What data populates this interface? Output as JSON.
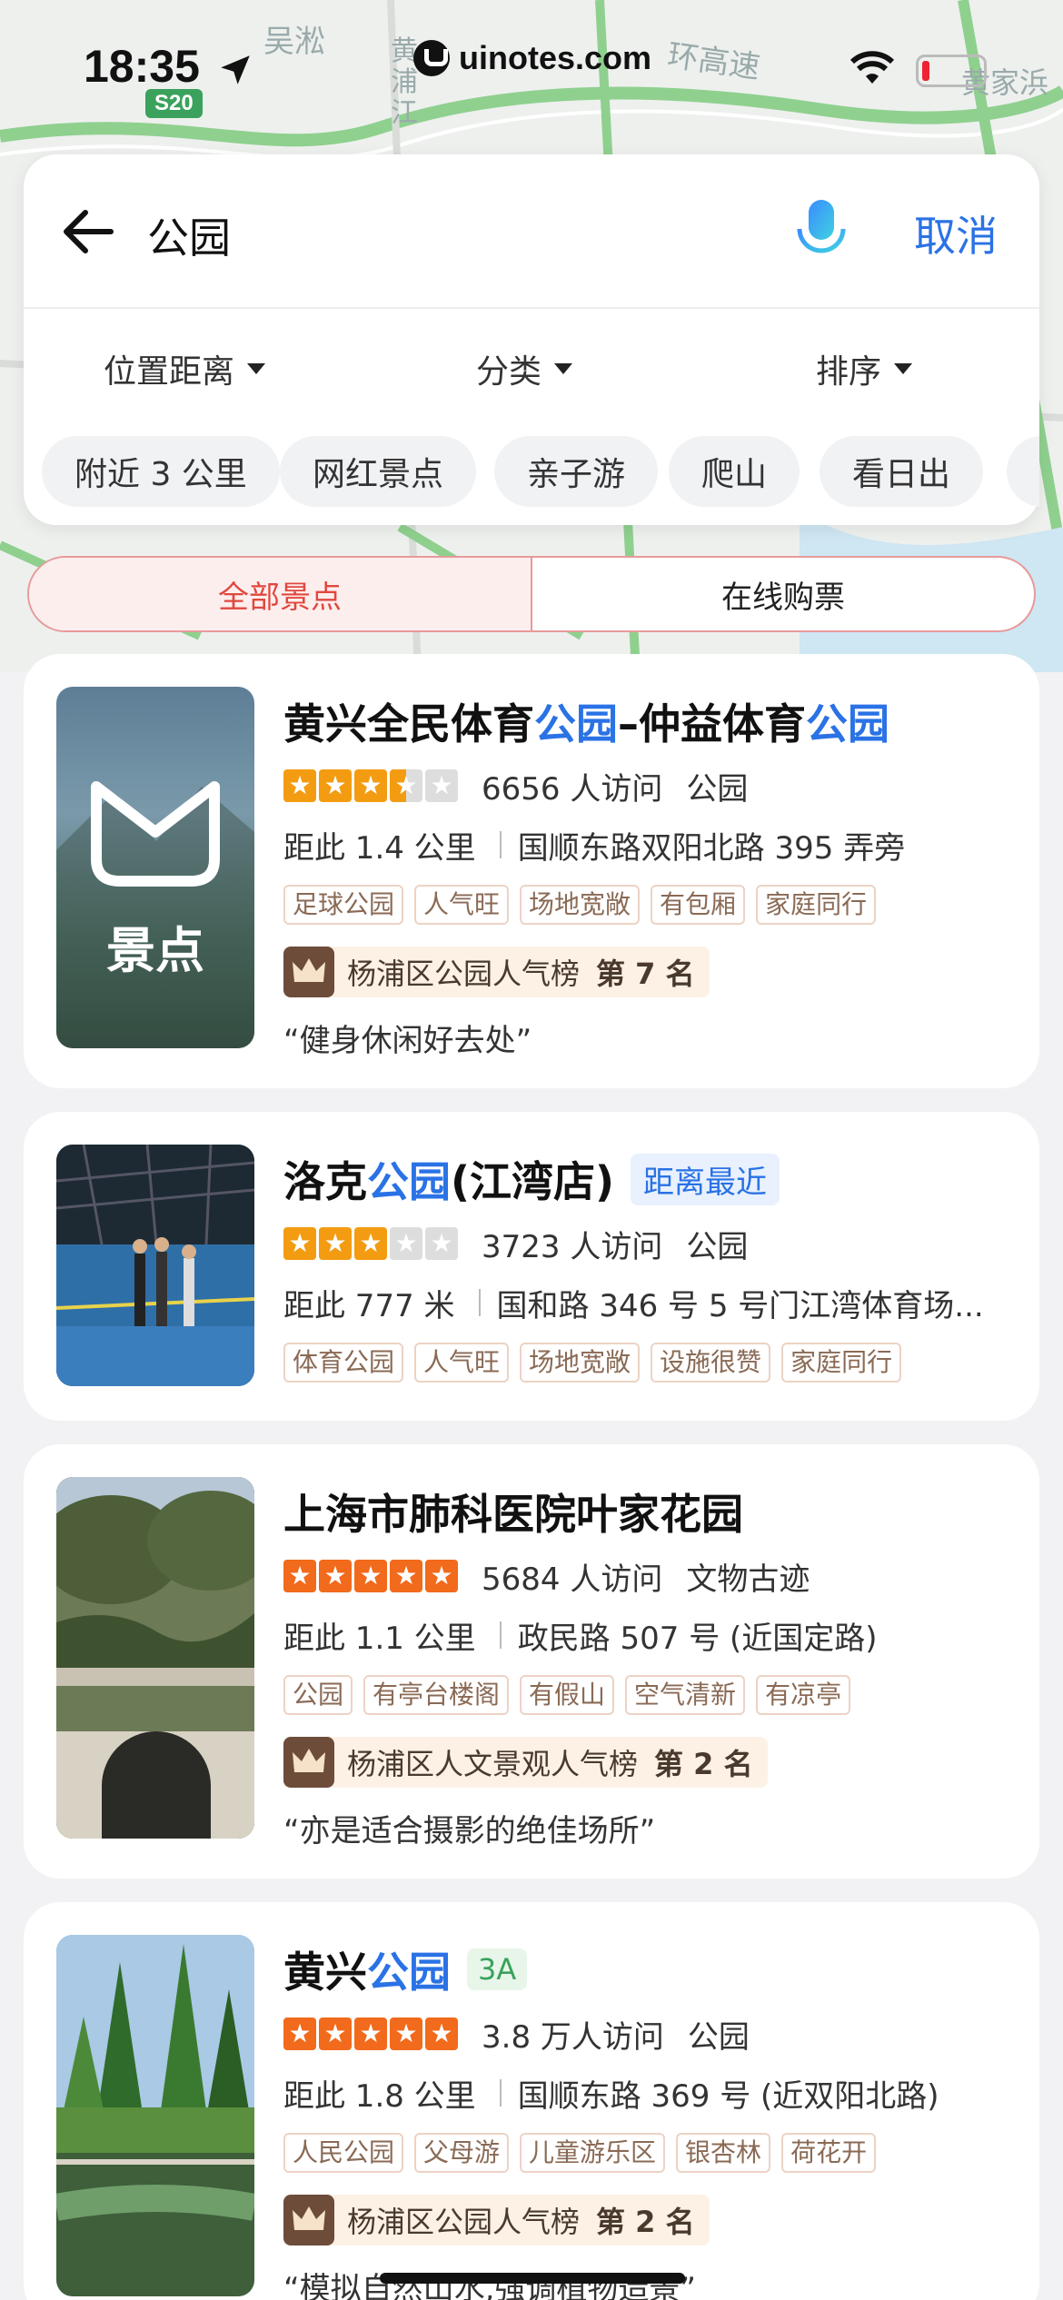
{
  "status_bar": {
    "time": "18:35",
    "site": "uinotes.com",
    "road_badge": "S20"
  },
  "map": {
    "labels": [
      "吴淞",
      "黄浦江",
      "环高速",
      "黄家浜"
    ]
  },
  "search": {
    "query": "公园",
    "cancel_label": "取消"
  },
  "filters": [
    {
      "label": "位置距离"
    },
    {
      "label": "分类"
    },
    {
      "label": "排序"
    }
  ],
  "chips": [
    "附近 3 公里",
    "网红景点",
    "亲子游",
    "爬山",
    "看日出"
  ],
  "segment": {
    "tab_all": "全部景点",
    "tab_tickets": "在线购票"
  },
  "results": [
    {
      "title_parts": [
        "黄兴全民体育",
        "公园",
        "–仲益体育",
        "公园"
      ],
      "thumb_label": "景点",
      "rating": 3.5,
      "visits": "6656 人访问",
      "category": "公园",
      "distance": "距此 1.4 公里",
      "address": "国顺东路双阳北路 395 弄旁",
      "tags": [
        "足球公园",
        "人气旺",
        "场地宽敞",
        "有包厢",
        "家庭同行"
      ],
      "rank_text": "杨浦区公园人气榜",
      "rank_pos": "第 7 名",
      "quote": "“健身休闲好去处”"
    },
    {
      "title_parts": [
        "洛克",
        "公园",
        "(江湾店)"
      ],
      "badge": "距离最近",
      "rating": 3,
      "visits": "3723 人访问",
      "category": "公园",
      "distance": "距此 777 米",
      "address": "国和路 346 号 5 号门江湾体育场...",
      "tags": [
        "体育公园",
        "人气旺",
        "场地宽敞",
        "设施很赞",
        "家庭同行"
      ]
    },
    {
      "title_parts": [
        "上海市肺科医院叶家花园"
      ],
      "rating": 5,
      "visits": "5684 人访问",
      "category": "文物古迹",
      "distance": "距此 1.1 公里",
      "address": "政民路 507 号 (近国定路)",
      "tags": [
        "公园",
        "有亭台楼阁",
        "有假山",
        "空气清新",
        "有凉亭"
      ],
      "rank_text": "杨浦区人文景观人气榜",
      "rank_pos": "第 2 名",
      "quote": "“亦是适合摄影的绝佳场所”"
    },
    {
      "title_parts": [
        "黄兴",
        "公园"
      ],
      "badge": "3A",
      "rating": 5,
      "visits": "3.8 万人访问",
      "category": "公园",
      "distance": "距此 1.8 公里",
      "address": "国顺东路 369 号 (近双阳北路)",
      "tags": [
        "人民公园",
        "父母游",
        "儿童游乐区",
        "银杏林",
        "荷花开"
      ],
      "rank_text": "杨浦区公园人气榜",
      "rank_pos": "第 2 名",
      "quote": "“模拟自然山水,强调植物造景”"
    }
  ],
  "colors": {
    "accent": "#2a72e5",
    "tab_active": "#e0483e",
    "star": "#f39c12",
    "star_full": "#f26a1b"
  },
  "icons": [
    "back-arrow-icon",
    "microphone-icon",
    "caret-down-icon",
    "star-icon",
    "crown-icon",
    "wifi-icon",
    "battery-icon",
    "location-arrow-icon"
  ]
}
